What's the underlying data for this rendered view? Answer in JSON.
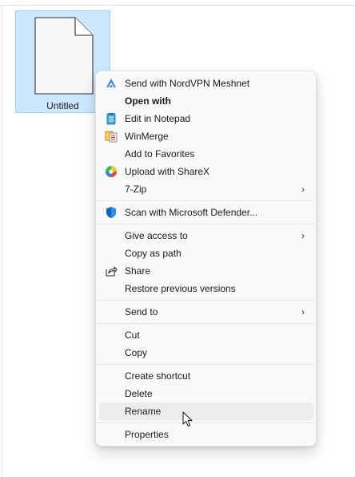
{
  "file": {
    "name": "Untitled",
    "icon": "blank-document-icon"
  },
  "menu": {
    "items": [
      {
        "label": "Send with NordVPN Meshnet",
        "icon": "nordvpn-icon"
      },
      {
        "label": "Open with",
        "bold": true
      },
      {
        "label": "Edit in Notepad",
        "icon": "notepad-icon"
      },
      {
        "label": "WinMerge",
        "icon": "winmerge-icon"
      },
      {
        "label": "Add to Favorites"
      },
      {
        "label": "Upload with ShareX",
        "icon": "sharex-icon"
      },
      {
        "label": "7-Zip",
        "submenu": true
      },
      {
        "label": "Scan with Microsoft Defender...",
        "icon": "defender-shield-icon"
      },
      {
        "label": "Give access to",
        "submenu": true
      },
      {
        "label": "Copy as path"
      },
      {
        "label": "Share",
        "icon": "share-icon"
      },
      {
        "label": "Restore previous versions"
      },
      {
        "label": "Send to",
        "submenu": true
      },
      {
        "label": "Cut"
      },
      {
        "label": "Copy"
      },
      {
        "label": "Create shortcut"
      },
      {
        "label": "Delete"
      },
      {
        "label": "Rename",
        "hovered": true
      },
      {
        "label": "Properties"
      }
    ],
    "submenu_chevron": "›"
  },
  "colors": {
    "selection": "#cce8ff",
    "selection_border": "#99d1ff",
    "menu_bg": "#f9f9f9",
    "hover_bg": "#ececec",
    "nordvpn": "#4687ff",
    "defender": "#0b64c0"
  }
}
